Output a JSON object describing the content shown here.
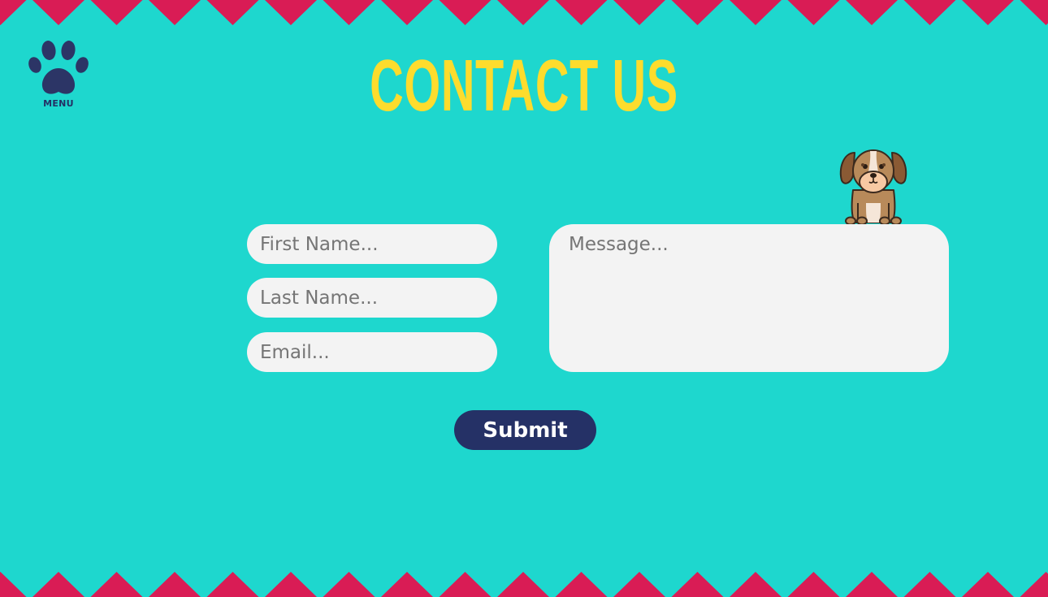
{
  "colors": {
    "background": "#1ed7ce",
    "zigzag": "#d91c55",
    "title": "#fddc2d",
    "navy": "#253166",
    "field": "#f3f3f3"
  },
  "menu": {
    "label": "MENU",
    "icon": "paw-icon"
  },
  "header": {
    "title": "CONTACT US"
  },
  "mascot": {
    "icon": "dog-icon"
  },
  "form": {
    "first_name_placeholder": "First Name...",
    "last_name_placeholder": "Last Name...",
    "email_placeholder": "Email...",
    "message_placeholder": "Message...",
    "submit_label": "Submit"
  }
}
